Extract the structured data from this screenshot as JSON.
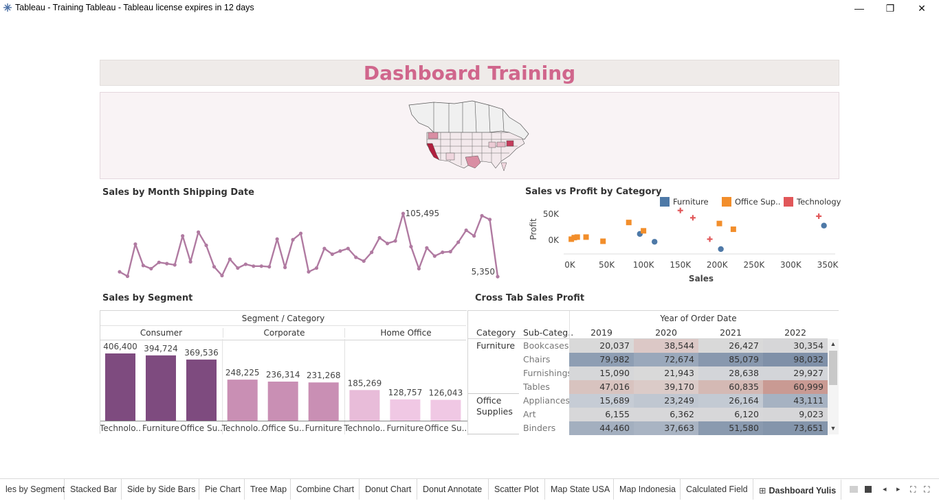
{
  "window": {
    "title": "Tableau - Training Tableau - Tableau license expires in 12 days",
    "controls": [
      "—",
      "❐",
      "✕"
    ]
  },
  "dashboard": {
    "title": "Dashboard Training",
    "title_color": "#d0668c"
  },
  "line_chart": {
    "title": "Sales by Month Shipping Date",
    "label_max": "105,495",
    "label_last": "5,350"
  },
  "scatter": {
    "title": "Sales vs Profit by Category",
    "legend": [
      {
        "name": "Furniture",
        "color": "#4e79a7"
      },
      {
        "name": "Office Sup..",
        "color": "#f28e2b"
      },
      {
        "name": "Technology",
        "color": "#e15759"
      }
    ],
    "xlabel": "Sales",
    "ylabel": "Profit",
    "xticks": [
      "0K",
      "50K",
      "100K",
      "150K",
      "200K",
      "250K",
      "300K",
      "350K"
    ],
    "yticks": [
      "50K",
      "0K"
    ]
  },
  "segment": {
    "title": "Sales by Segment",
    "header": "Segment / Category",
    "groups": [
      {
        "name": "Consumer"
      },
      {
        "name": "Corporate"
      },
      {
        "name": "Home Office"
      }
    ]
  },
  "crosstab": {
    "title": "Cross Tab Sales Profit",
    "header": "Year of Order Date",
    "col_category": "Category",
    "col_subcategory": "Sub-Categ..",
    "years": [
      "2019",
      "2020",
      "2021",
      "2022"
    ],
    "categories": [
      {
        "name": "Furniture",
        "rows": 4
      },
      {
        "name": "Office Supplies",
        "rows": 3
      }
    ],
    "rows": [
      {
        "sub": "Bookcases",
        "values": [
          "20,037",
          "38,544",
          "26,427",
          "30,354"
        ],
        "colors": [
          "#d9d9d9",
          "#dcc8c6",
          "#d9d9d9",
          "#d6d6d8"
        ]
      },
      {
        "sub": "Chairs",
        "values": [
          "79,982",
          "72,674",
          "85,079",
          "98,032"
        ],
        "colors": [
          "#8e9eb3",
          "#9aa8bb",
          "#8898ae",
          "#7f90a8"
        ]
      },
      {
        "sub": "Furnishings",
        "values": [
          "15,090",
          "21,943",
          "28,638",
          "29,927"
        ],
        "colors": [
          "#d6d7d9",
          "#d9d9d9",
          "#d3d5d9",
          "#d3d5d9"
        ]
      },
      {
        "sub": "Tables",
        "values": [
          "47,016",
          "39,170",
          "60,835",
          "60,999"
        ],
        "colors": [
          "#d8c3bf",
          "#dbcbc8",
          "#d4b9b4",
          "#c99a93"
        ]
      },
      {
        "sub": "Appliances",
        "values": [
          "15,689",
          "23,249",
          "26,164",
          "43,111"
        ],
        "colors": [
          "#c6ccd5",
          "#c0c7d1",
          "#c3cad3",
          "#a6b2c2"
        ]
      },
      {
        "sub": "Art",
        "values": [
          "6,155",
          "6,362",
          "6,120",
          "9,023"
        ],
        "colors": [
          "#d7d7d9",
          "#d7d7d9",
          "#d7d7d9",
          "#d6d6d8"
        ]
      },
      {
        "sub": "Binders",
        "values": [
          "44,460",
          "37,663",
          "51,580",
          "73,651"
        ],
        "colors": [
          "#a3afbf",
          "#a9b4c3",
          "#8a9aaf",
          "#8495ab"
        ]
      }
    ]
  },
  "chart_data": [
    {
      "type": "line",
      "title": "Sales by Month Shipping Date",
      "color": "#b07aa1",
      "note_points": {
        "max": 105495,
        "last": 5350
      },
      "values": [
        13000,
        6000,
        57000,
        23000,
        18000,
        28000,
        26000,
        24000,
        70000,
        29000,
        76000,
        55000,
        21000,
        7000,
        33000,
        19000,
        25000,
        22000,
        22000,
        21000,
        65000,
        20000,
        64000,
        74000,
        13000,
        19000,
        50000,
        41000,
        46000,
        50000,
        36000,
        30000,
        44000,
        67000,
        58000,
        62000,
        105495,
        53000,
        18000,
        51000,
        38000,
        44000,
        45000,
        60000,
        79000,
        70000,
        102000,
        96000,
        5350
      ]
    },
    {
      "type": "scatter",
      "title": "Sales vs Profit by Category",
      "xlabel": "Sales",
      "ylabel": "Profit",
      "xlim": [
        0,
        350000
      ],
      "series": [
        {
          "name": "Furniture",
          "points": [
            [
              95000,
              12000
            ],
            [
              115000,
              -3000
            ],
            [
              205000,
              -17000
            ],
            [
              345000,
              28000
            ]
          ]
        },
        {
          "name": "Office Sup..",
          "points": [
            [
              2000,
              2000
            ],
            [
              6000,
              5000
            ],
            [
              10000,
              6000
            ],
            [
              22000,
              6000
            ],
            [
              45000,
              -2000
            ],
            [
              80000,
              34000
            ],
            [
              100000,
              18000
            ],
            [
              203000,
              32000
            ],
            [
              222000,
              21000
            ]
          ]
        },
        {
          "name": "Technology",
          "points": [
            [
              150000,
              57000
            ],
            [
              167000,
              43000
            ],
            [
              190000,
              2000
            ],
            [
              338000,
              46000
            ]
          ]
        }
      ]
    },
    {
      "type": "bar",
      "title": "Sales by Segment",
      "series": [
        {
          "name": "Consumer",
          "categories": [
            "Technolo..",
            "Furniture",
            "Office Su.."
          ],
          "values": [
            406400,
            394724,
            369536
          ],
          "labels": [
            "406,400",
            "394,724",
            "369,536"
          ],
          "color": "#7e4b7f"
        },
        {
          "name": "Corporate",
          "categories": [
            "Technolo..",
            "Office Su..",
            "Furniture"
          ],
          "values": [
            248225,
            236314,
            231268
          ],
          "labels": [
            "248,225",
            "236,314",
            "231,268"
          ],
          "color": "#c98fb4"
        },
        {
          "name": "Home Office",
          "categories": [
            "Technolo..",
            "Furniture",
            "Office Su.."
          ],
          "values": [
            185269,
            128757,
            126043
          ],
          "labels": [
            "185,269",
            "128,757",
            "126,043"
          ],
          "color": "#e8bcd9"
        }
      ]
    }
  ],
  "tabs": [
    {
      "label": "les by Segment"
    },
    {
      "label": "Stacked Bar"
    },
    {
      "label": "Side by Side Bars"
    },
    {
      "label": "Pie Chart"
    },
    {
      "label": "Tree Map"
    },
    {
      "label": "Combine Chart"
    },
    {
      "label": "Donut Chart"
    },
    {
      "label": "Donut Annotate"
    },
    {
      "label": "Scatter Plot"
    },
    {
      "label": "Map State USA"
    },
    {
      "label": "Map Indonesia"
    },
    {
      "label": "Calculated Field"
    },
    {
      "label": "Dashboard Yulis"
    }
  ]
}
